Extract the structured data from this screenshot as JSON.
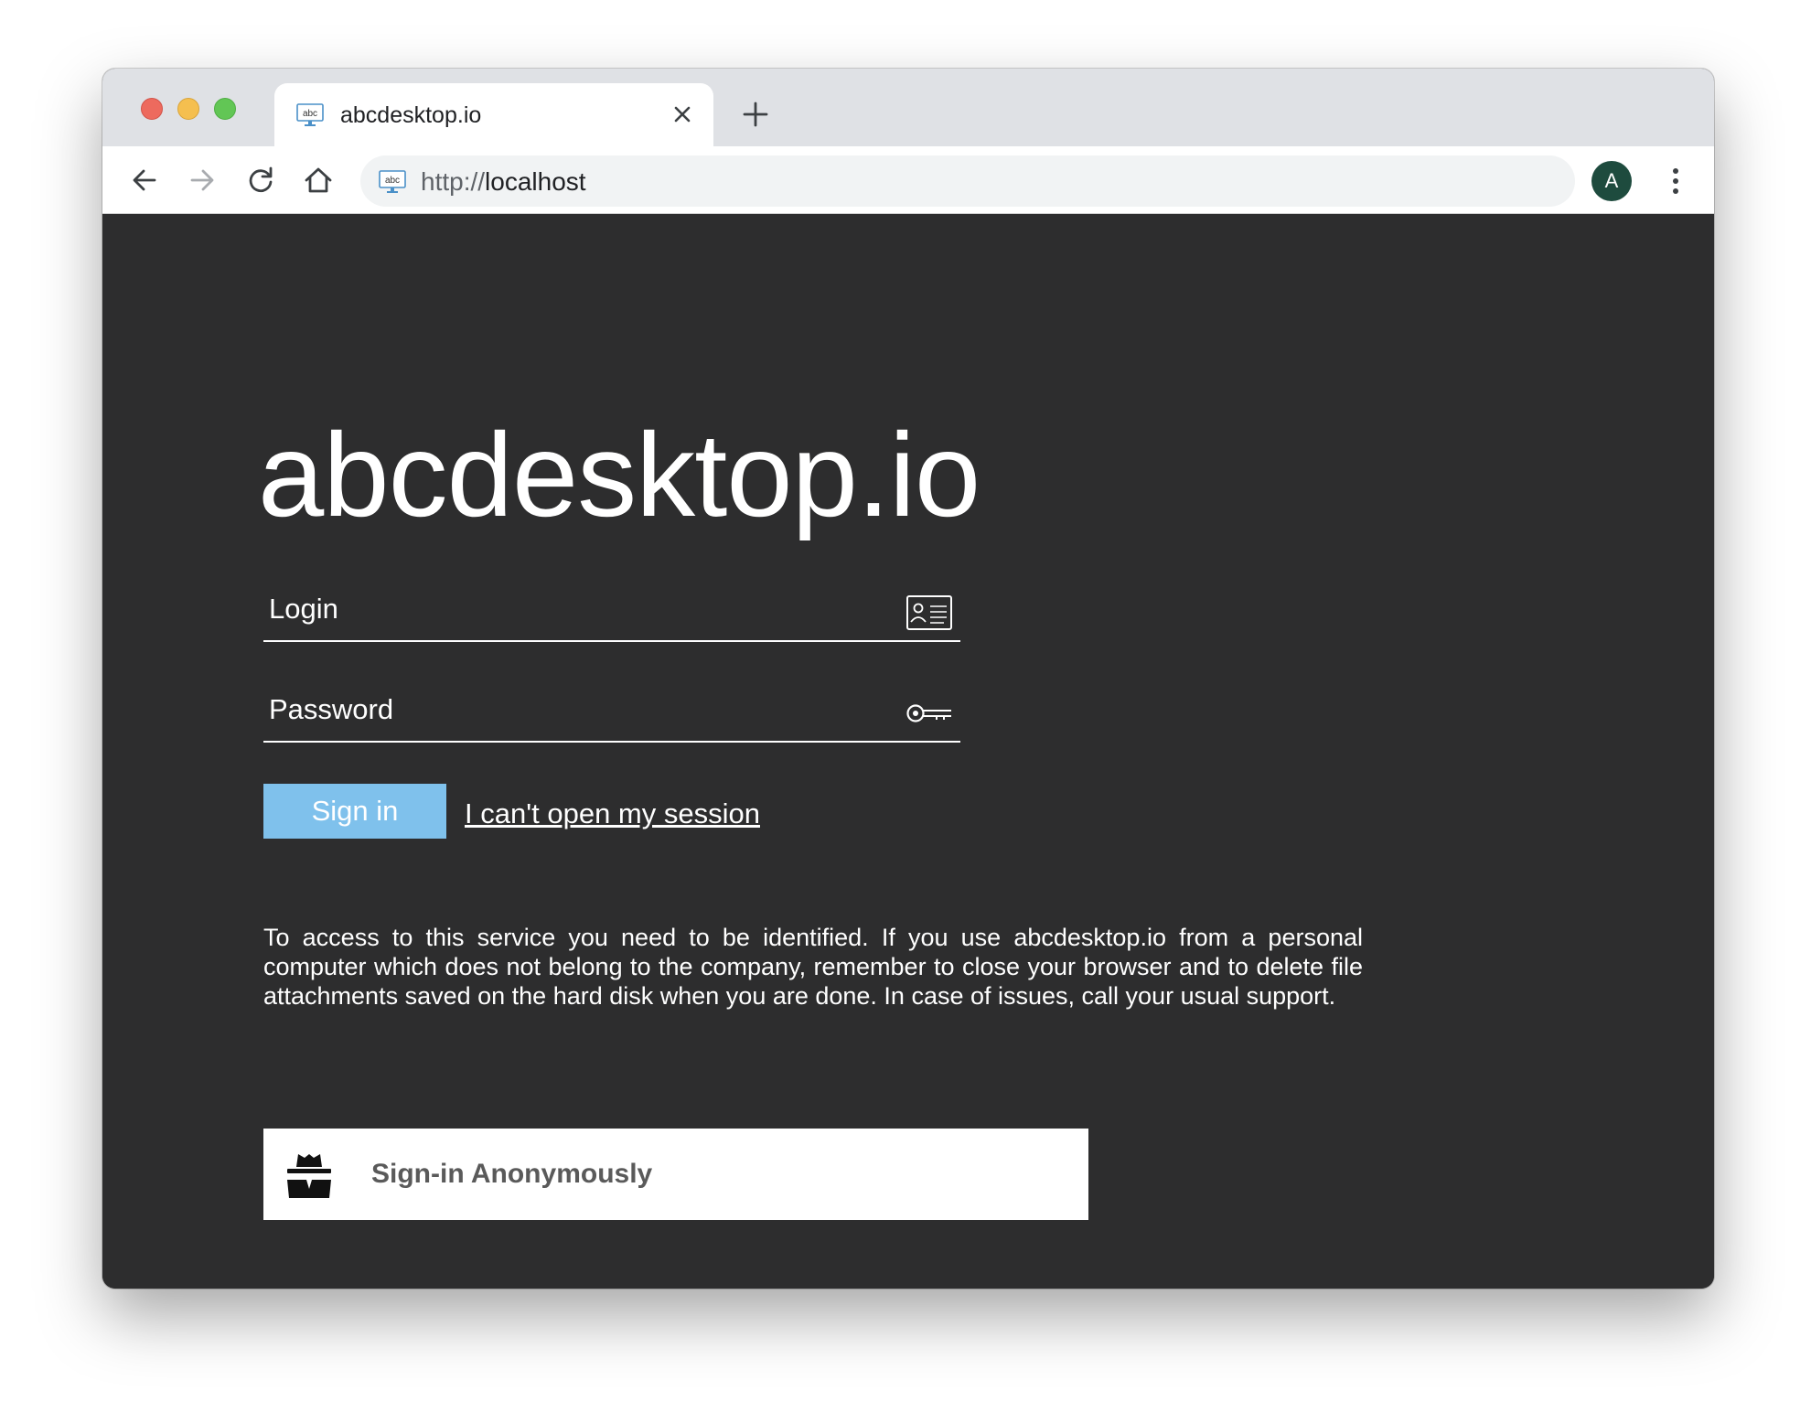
{
  "browser": {
    "tab": {
      "favicon": "abc-monitor-icon",
      "title": "abcdesktop.io"
    },
    "address_bar": {
      "scheme": "http://",
      "host": "localhost"
    },
    "avatar_initial": "A",
    "favicon_text": "abc"
  },
  "login_page": {
    "title": "abcdesktop.io",
    "login_field": {
      "placeholder": "Login",
      "value": "",
      "icon": "id-card-icon"
    },
    "password_field": {
      "placeholder": "Password",
      "value": "",
      "icon": "key-icon"
    },
    "sign_in_label": "Sign in",
    "help_link": "I can't open my session",
    "notice": "To access to this service you need to be identified. If you use abcdesktop.io from a personal computer which does not belong to the company, remember to close your browser and to delete file attachments saved on the hard disk when you are done. In case of issues, call your usual support.",
    "anonymous": {
      "label": "Sign-in Anonymously",
      "icon": "incognito-spy-icon"
    }
  },
  "colors": {
    "page_background": "#2d2d2e",
    "sign_in_button": "#7fc1ec",
    "avatar": "#1e4b3e"
  }
}
